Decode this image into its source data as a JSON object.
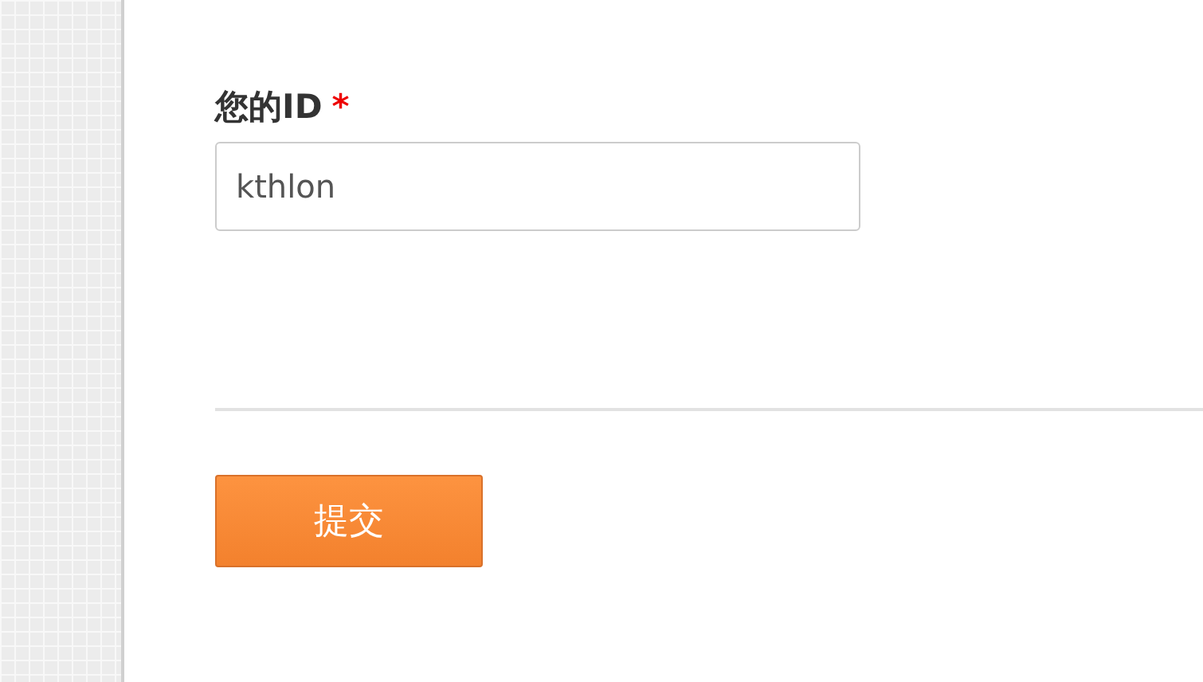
{
  "form": {
    "field": {
      "label": "您的ID",
      "required_mark": "*",
      "value": "kthlon"
    },
    "submit": {
      "label": "提交"
    }
  }
}
